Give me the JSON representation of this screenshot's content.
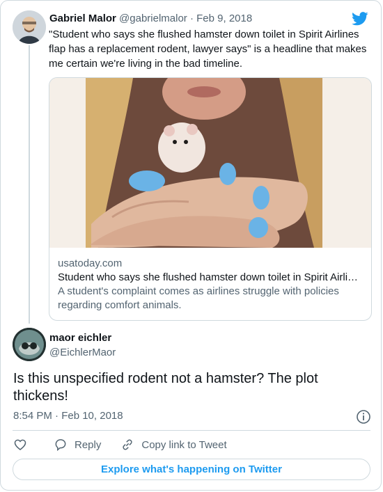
{
  "quoted_tweet": {
    "author_name": "Gabriel Malor",
    "author_handle": "@gabrielmalor",
    "date_sep": " · ",
    "date": "Feb 9, 2018",
    "text": "\"Student who says she flushed hamster down toilet in Spirit Airlines flap has a replacement rodent, lawyer says\" is a headline that makes me certain we're living in the bad timeline.",
    "link_card": {
      "domain": "usatoday.com",
      "title": "Student who says she flushed hamster down toilet in Spirit Airli…",
      "description": "A student's complaint comes as airlines struggle with policies regarding comfort animals."
    }
  },
  "tweet": {
    "author_name": "maor eichler",
    "author_handle": "@EichlerMaor",
    "text": "Is this unspecified rodent not a hamster? The plot thickens!",
    "timestamp": "8:54 PM · Feb 10, 2018"
  },
  "actions": {
    "like_icon": "heart-icon",
    "reply_label": "Reply",
    "copy_label": "Copy link to Tweet"
  },
  "explore_label": "Explore what's happening on Twitter",
  "colors": {
    "twitter_blue": "#1d9bf0",
    "muted_text": "#536471",
    "border": "#cfd9de",
    "nail_polish": "#6ab3e6"
  }
}
